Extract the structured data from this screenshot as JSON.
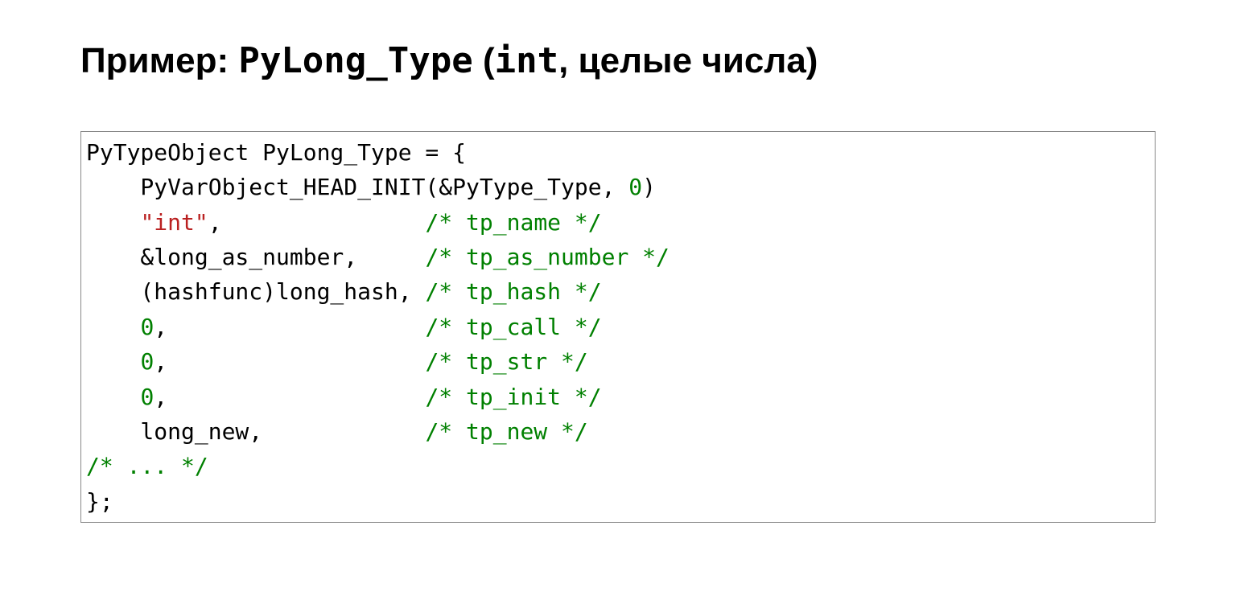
{
  "title": {
    "t1": "Пример: ",
    "mono1": "PyLong_Type",
    "t2": " (",
    "mono2": "int",
    "t3": ", целые числа)"
  },
  "code": {
    "l1_a": "PyTypeObject PyLong_Type = {",
    "l2_a": "    PyVarObject_HEAD_INIT(&PyType_Type, ",
    "l2_num": "0",
    "l2_b": ")",
    "l3_a": "    ",
    "l3_str": "\"int\"",
    "l3_b": ",               ",
    "l3_c": "/* tp_name */",
    "l4_a": "    &long_as_number,     ",
    "l4_c": "/* tp_as_number */",
    "l5_a": "    (hashfunc)long_hash, ",
    "l5_c": "/* tp_hash */",
    "l6_a": "    ",
    "l6_num": "0",
    "l6_b": ",                   ",
    "l6_c": "/* tp_call */",
    "l7_a": "    ",
    "l7_num": "0",
    "l7_b": ",                   ",
    "l7_c": "/* tp_str */",
    "l8_a": "    ",
    "l8_num": "0",
    "l8_b": ",                   ",
    "l8_c": "/* tp_init */",
    "l9_a": "    long_new,            ",
    "l9_c": "/* tp_new */",
    "l10_c": "/* ... */",
    "l11_a": "};"
  }
}
